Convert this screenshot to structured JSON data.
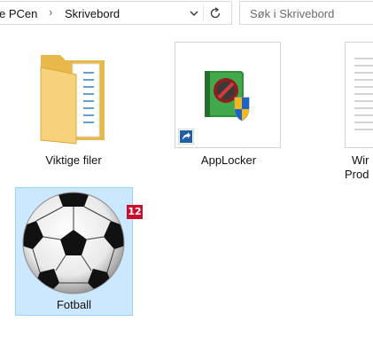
{
  "address_bar": {
    "breadcrumbs": [
      "e PCen",
      "Skrivebord"
    ],
    "dropdown_icon": "chevron-down-icon",
    "refresh_icon": "refresh-icon"
  },
  "search": {
    "placeholder": "Søk i Skrivebord"
  },
  "desktop_items": [
    {
      "label": "Viktige filer",
      "icon": "folder-icon"
    },
    {
      "label": "AppLocker",
      "icon": "applocker-icon",
      "shortcut": true
    },
    {
      "label_line1": "Wir",
      "label_line2": "Prod",
      "icon": "document-icon"
    },
    {
      "label": "Fotball",
      "icon": "soccer-ball-icon",
      "selected": true,
      "badge": "12"
    }
  ],
  "colors": {
    "selection_fill": "#cce8ff",
    "selection_border": "#99d1ff",
    "badge": "#c8102e"
  }
}
